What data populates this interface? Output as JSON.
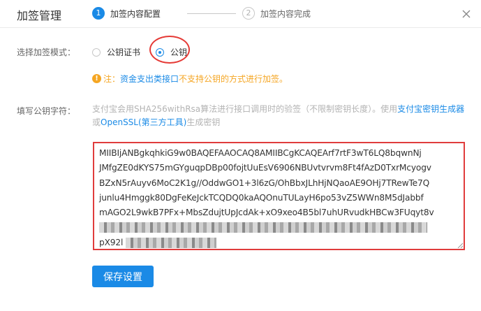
{
  "dialog": {
    "title": "加签管理",
    "close_icon": "close-icon"
  },
  "steps": [
    {
      "number": "1",
      "label": "加签内容配置",
      "state": "active"
    },
    {
      "number": "2",
      "label": "加签内容完成",
      "state": "pending"
    }
  ],
  "mode": {
    "label": "选择加签模式：",
    "options": [
      {
        "label": "公钥证书",
        "checked": false
      },
      {
        "label": "公钥",
        "checked": true
      }
    ]
  },
  "notice": {
    "icon": "warning-icon",
    "label": "注：",
    "link_text": "资金支出类接口",
    "warning_text": "不支持公钥的方式进行加签。"
  },
  "key_field": {
    "label": "填写公钥字符：",
    "hint_prefix": "支付宝会用SHA256withRsa算法进行接口调用时的验签（不限制密钥长度）。使用",
    "hint_link1": "支付宝密钥生成器",
    "hint_or": "或",
    "hint_link2": "OpenSSL(第三方工具)",
    "hint_suffix": "生成密钥",
    "value_lines": [
      "MIIBIjANBgkqhkiG9w0BAQEFAAOCAQ8AMIIBCgKCAQEArf7rtF3wT6LQ8bqwnNj",
      "JMfgZE0dKYS75mGYguqpDBp00fojtUuEsV6906NBUvtvrvm8Ft4fAzD0TxrMcyogv",
      "BZxN5rAuyv6MoC2K1g//OddwGO1+3l6zG/OhBbxJLhHjNQaoAE9OHj7TRewTe7Q",
      "junlu4Hmggk80DgFeKeJckTCQDQ0kaAQOnuTULayH6po53vZ5WWn8M5dJabbf",
      "mAGO2L9wkB7PFx+MbsZdujtUpJcdAk+xO9xeo4B5bl7uhURvudkHBCw3FUqyt8v"
    ],
    "redacted_fragment": "pX92l"
  },
  "actions": {
    "save_label": "保存设置"
  },
  "colors": {
    "primary": "#1a8ae6",
    "warning": "#f5a623",
    "annotation": "#e53935"
  }
}
